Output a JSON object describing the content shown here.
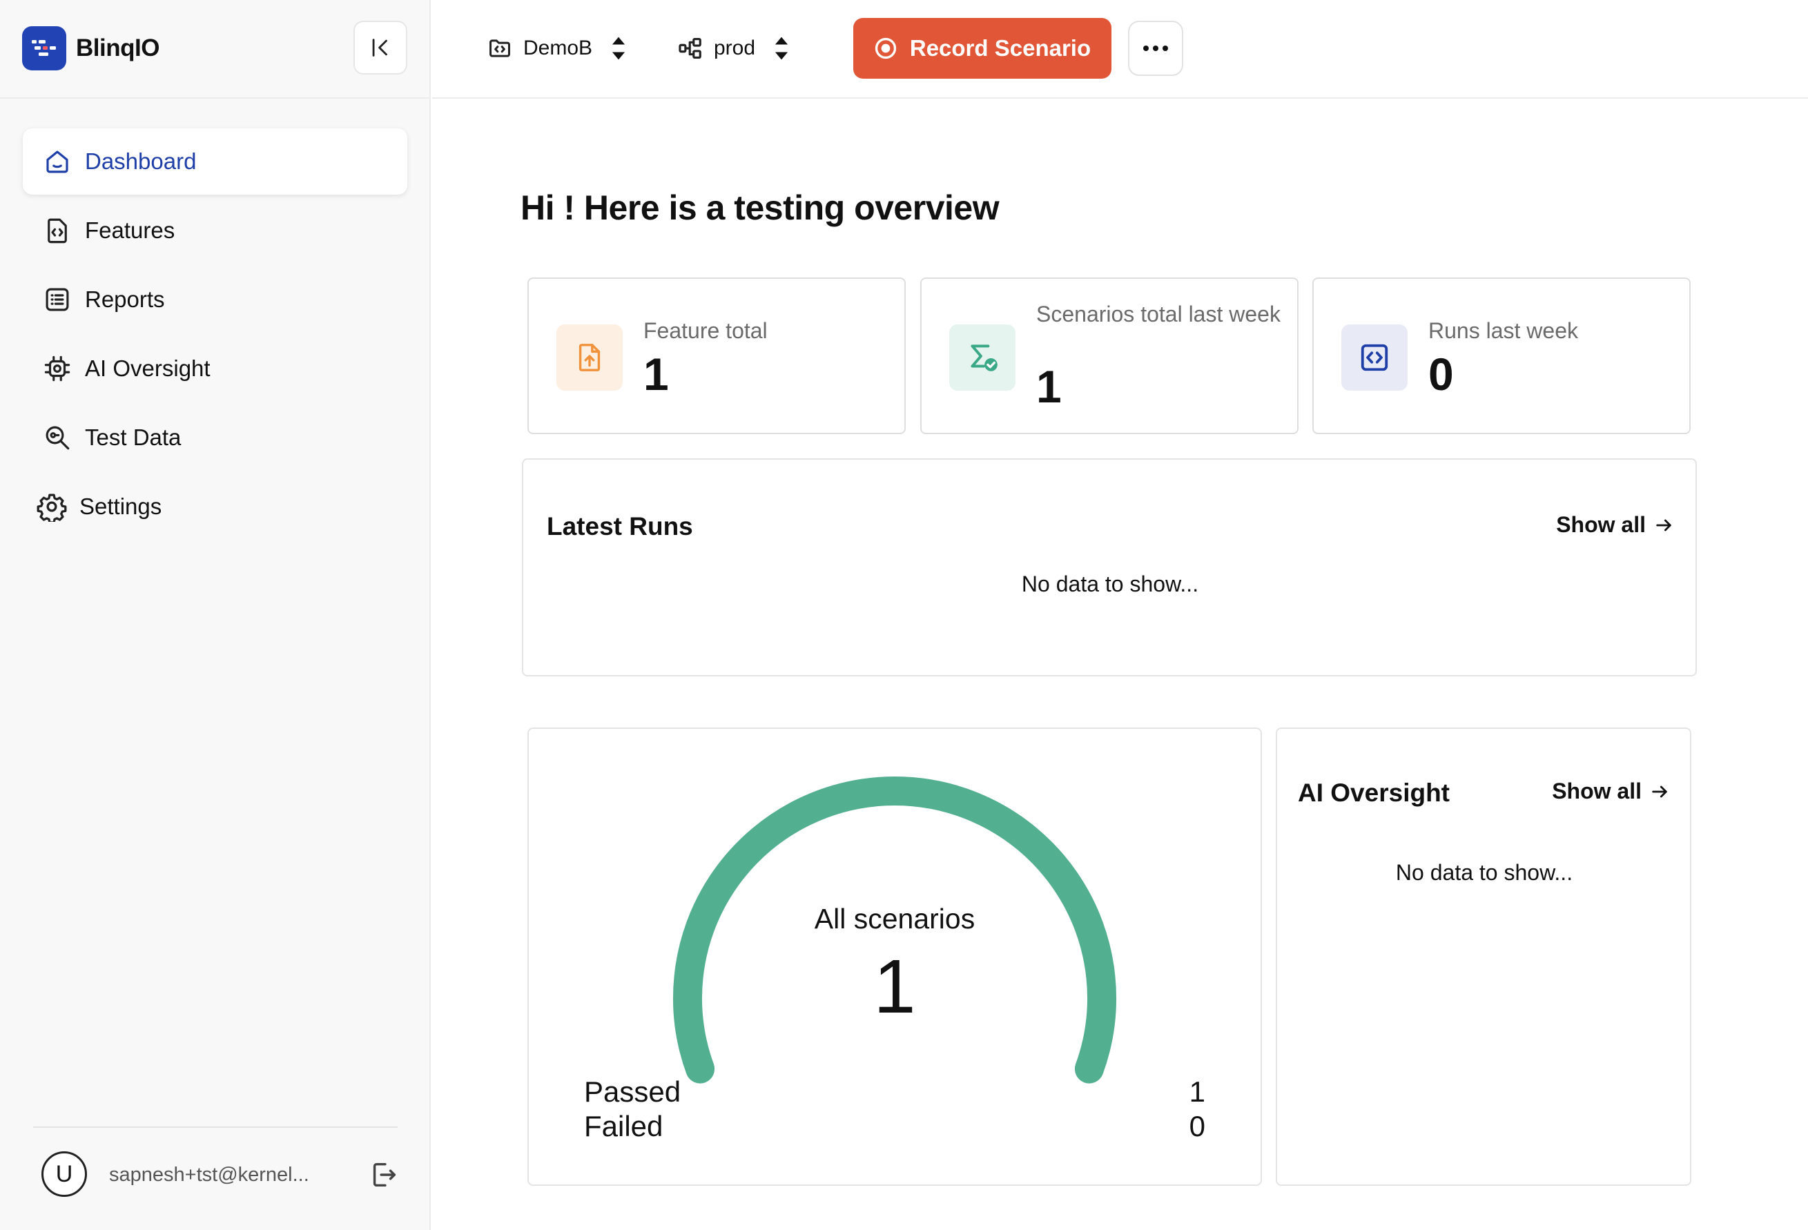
{
  "brand": {
    "name": "BlinqIO",
    "color": "#2143b4"
  },
  "sidebar": {
    "items": [
      {
        "label": "Dashboard",
        "icon": "home-icon",
        "active": true
      },
      {
        "label": "Features",
        "icon": "file-code-icon",
        "active": false
      },
      {
        "label": "Reports",
        "icon": "list-icon",
        "active": false
      },
      {
        "label": "AI Oversight",
        "icon": "chip-icon",
        "active": false
      },
      {
        "label": "Test Data",
        "icon": "search-key-icon",
        "active": false
      },
      {
        "label": "Settings",
        "icon": "gear-icon",
        "active": false
      }
    ],
    "user": {
      "initial": "U",
      "email": "sapnesh+tst@kernel..."
    }
  },
  "topbar": {
    "project": "DemoB",
    "environment": "prod",
    "record_label": "Record Scenario",
    "record_color": "#e05637"
  },
  "main": {
    "title": "Hi ! Here is a testing overview",
    "stats": [
      {
        "label": "Feature total",
        "value": "1",
        "icon": "file-upload-icon",
        "color": "#f0923b"
      },
      {
        "label": "Scenarios total last week",
        "value": "1",
        "icon": "sigma-check-icon",
        "color": "#3aa987"
      },
      {
        "label": "Runs last week",
        "value": "0",
        "icon": "code-icon",
        "color": "#1e3fa8"
      }
    ],
    "latest_runs": {
      "title": "Latest Runs",
      "show_all": "Show all",
      "empty": "No data to show..."
    },
    "scenarios": {
      "label": "All scenarios",
      "total": "1",
      "passed_label": "Passed",
      "passed_value": "1",
      "failed_label": "Failed",
      "failed_value": "0",
      "passed_fraction": 1,
      "gauge_color": "#52b091"
    },
    "ai_oversight": {
      "title": "AI Oversight",
      "show_all": "Show all",
      "empty": "No data to show..."
    }
  }
}
